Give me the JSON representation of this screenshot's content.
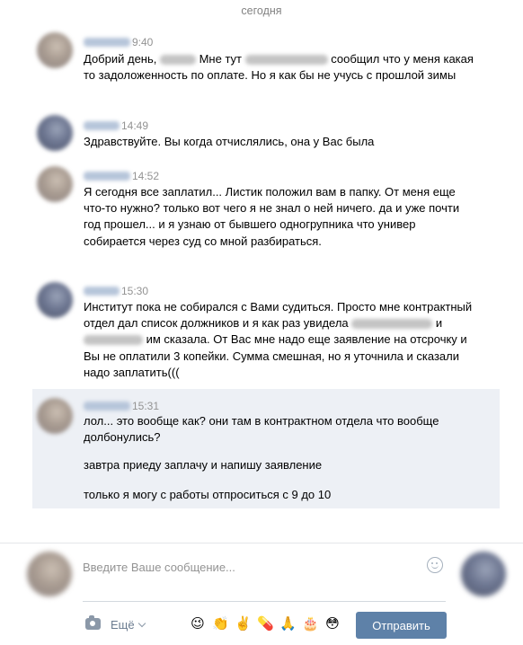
{
  "date_separator": "сегодня",
  "messages": [
    {
      "time": "9:40",
      "text_parts": [
        "Добрий день, ",
        " Мне тут ",
        " сообщил что у меня какая то задоложенность по оплате. Но я как бы не учусь с прошлой зимы"
      ]
    },
    {
      "time": "14:49",
      "text": "Здравствуйте. Вы когда отчислялись, она у Вас была"
    },
    {
      "time": "14:52",
      "text": "Я сегодня все заплатил... Листик положил вам в папку. От меня еще что-то нужно? только вот чего я не знал о ней ничего. да и уже почти год прошел... и я узнаю от бывшего одногрупника что универ собирается через суд со мной разбираться."
    },
    {
      "time": "15:30",
      "text_parts": [
        "Институт пока не собирался с Вами судиться. Просто мне контрактный отдел дал список должников и я как раз увидела ",
        " и ",
        " им сказала. От Вас мне надо еще заявление на отсрочку и Вы не оплатили 3 копейки. Сумма смешная, но я уточнила и сказали надо заплатить((("
      ]
    },
    {
      "time": "15:31",
      "lines": [
        "лол... это вообще как? они там в контрактном отдела что вообще долбонулись?",
        "завтра приеду заплачу и напишу заявление",
        "только я могу с работы отпроситься с 9 до 10"
      ]
    }
  ],
  "composer": {
    "placeholder": "Введите Ваше сообщение...",
    "more_label": "Ещё",
    "send_label": "Отправить",
    "quick_emoji": [
      "😉",
      "👏",
      "✌️",
      "💊",
      "🙏",
      "🎂",
      "😳"
    ]
  }
}
